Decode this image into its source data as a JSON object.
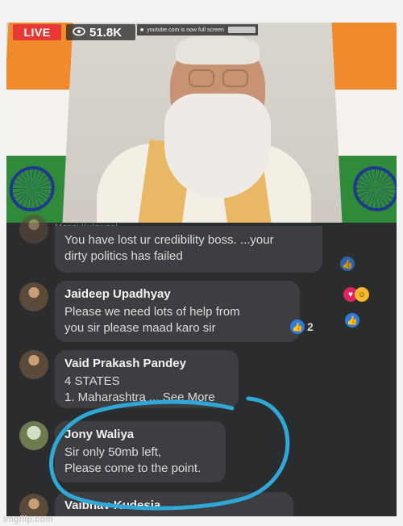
{
  "stream": {
    "live_label": "LIVE",
    "viewer_count": "51.8K",
    "banner_text": "youtube.com is now full screen"
  },
  "colors": {
    "live_red": "#e53935",
    "saffron": "#f08a2c",
    "green": "#2f8a3a",
    "like_blue": "#2e7be0",
    "annotation_circle": "#2fa8d8"
  },
  "comments": [
    {
      "name": "Manoj Kulowaal",
      "text": "You have lost ur credibility boss. ...your\ndirty politics has failed",
      "reactions": ""
    },
    {
      "name": "Jaideep Upadhyay",
      "text": "Please we need lots of help from\nyou sir please maad karo sir",
      "reactions": "2"
    },
    {
      "name": "Vaid Prakash Pandey",
      "text": "4 STATES\n1. Maharashtra ... See More",
      "reactions": ""
    },
    {
      "name": "Jony Waliya",
      "text": "Sir only 50mb left,\nPlease come to the point.",
      "reactions": ""
    },
    {
      "name": "Vaibhav Kudesia",
      "text": "",
      "reactions": ""
    }
  ],
  "watermark": "imgflip.com"
}
